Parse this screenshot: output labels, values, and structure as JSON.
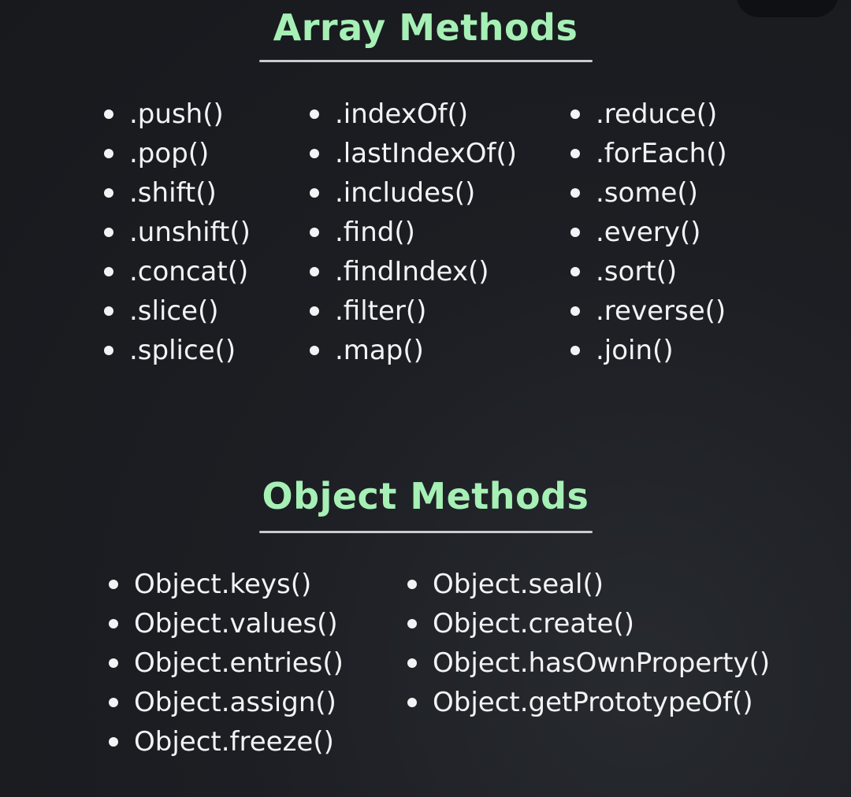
{
  "array_section": {
    "title": "Array Methods",
    "columns": [
      [
        ".push()",
        ".pop()",
        ".shift()",
        ".unshift()",
        ".concat()",
        ".slice()",
        ".splice()"
      ],
      [
        ".indexOf()",
        ".lastIndexOf()",
        ".includes()",
        ".find()",
        ".findIndex()",
        ".filter()",
        ".map()"
      ],
      [
        ".reduce()",
        ".forEach()",
        ".some()",
        ".every()",
        ".sort()",
        ".reverse()",
        ".join()"
      ]
    ]
  },
  "object_section": {
    "title": "Object Methods",
    "columns": [
      [
        "Object.keys()",
        "Object.values()",
        "Object.entries()",
        "Object.assign()",
        "Object.freeze()"
      ],
      [
        "Object.seal()",
        "Object.create()",
        "Object.hasOwnProperty()",
        "Object.getPrototypeOf()"
      ]
    ]
  },
  "colors": {
    "background": "#1c1e23",
    "title": "#a6f0b6",
    "text": "#f2f3f5",
    "rule": "#c9cbd0"
  }
}
